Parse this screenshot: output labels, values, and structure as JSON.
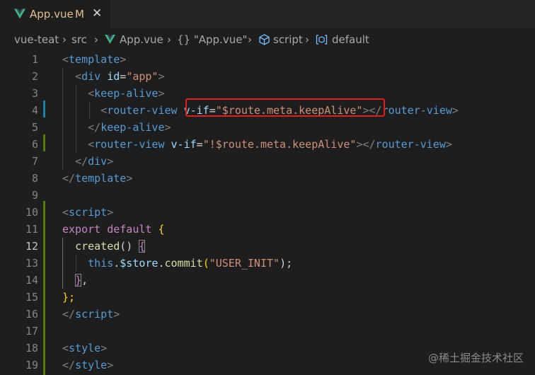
{
  "tab": {
    "name": "App.vue",
    "modified": "M",
    "close": "✕"
  },
  "breadcrumb": {
    "items": [
      "vue-teat",
      "src",
      "App.vue",
      "{} \"App.vue\"",
      "script",
      "default"
    ]
  },
  "colors": {
    "vue_green": "#41b883",
    "tab_modified": "#e2c08d",
    "highlight_red": "#e02020"
  },
  "editor": {
    "line_numbers": [
      "1",
      "2",
      "3",
      "4",
      "5",
      "6",
      "7",
      "8",
      "9",
      "10",
      "11",
      "12",
      "13",
      "14",
      "15",
      "16",
      "17",
      "18",
      "19"
    ],
    "active_line": "12",
    "lines": {
      "l1": {
        "a": "<",
        "b": "template",
        "c": ">"
      },
      "l2": {
        "a": "<",
        "b": "div",
        "c": "id",
        "d": "=",
        "e": "\"app\"",
        "f": ">"
      },
      "l3": {
        "a": "<",
        "b": "keep-alive",
        "c": ">"
      },
      "l4": {
        "a": "<",
        "b": "router-view",
        "c": "v-if",
        "d": "=",
        "e": "\"$route.meta.keepAlive\"",
        "f": "></",
        "g": "router-view",
        "h": ">"
      },
      "l5": {
        "a": "</",
        "b": "keep-alive",
        "c": ">"
      },
      "l6": {
        "a": "<",
        "b": "router-view",
        "c": "v-if",
        "d": "=",
        "e": "\"!$route.meta.keepAlive\"",
        "f": "></",
        "g": "router-view",
        "h": ">"
      },
      "l7": {
        "a": "</",
        "b": "div",
        "c": ">"
      },
      "l8": {
        "a": "</",
        "b": "template",
        "c": ">"
      },
      "l10": {
        "a": "<",
        "b": "script",
        "c": ">"
      },
      "l11": {
        "a": "export",
        "b": "default",
        "c": "{"
      },
      "l12": {
        "a": "created",
        "b": "()",
        "c": "{"
      },
      "l13": {
        "a": "this",
        "b": ".",
        "c": "$store",
        "d": ".",
        "e": "commit",
        "f": "(",
        "g": "\"USER_INIT\"",
        "h": ");"
      },
      "l14": {
        "a": "}",
        "b": ","
      },
      "l15": {
        "a": "};"
      },
      "l16": {
        "a": "</",
        "b": "script",
        "c": ">"
      },
      "l18": {
        "a": "<",
        "b": "style",
        "c": ">"
      },
      "l19": {
        "a": "</",
        "b": "style",
        "c": ">"
      }
    }
  },
  "watermark": "@稀土掘金技术社区"
}
